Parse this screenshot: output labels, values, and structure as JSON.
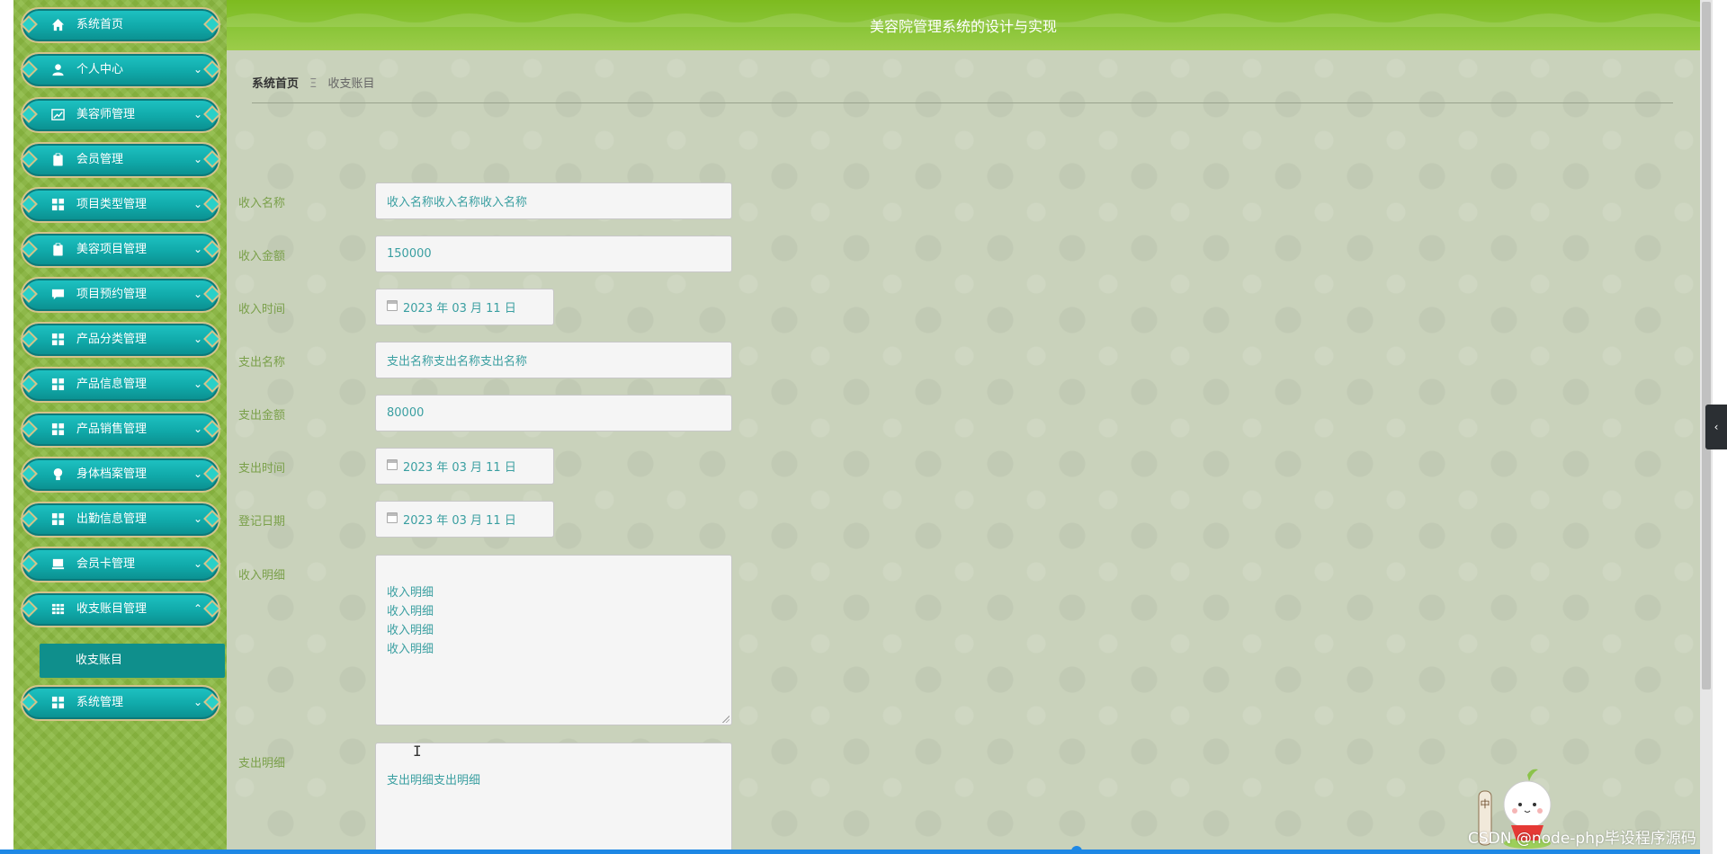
{
  "header": {
    "title": "美容院管理系统的设计与实现"
  },
  "sidebar": {
    "items": [
      {
        "label": "系统首页",
        "icon": "home-icon"
      },
      {
        "label": "个人中心",
        "icon": "user-icon"
      },
      {
        "label": "美容师管理",
        "icon": "chart-icon"
      },
      {
        "label": "会员管理",
        "icon": "clipboard-icon"
      },
      {
        "label": "项目类型管理",
        "icon": "grid-icon"
      },
      {
        "label": "美容项目管理",
        "icon": "clipboard-icon"
      },
      {
        "label": "项目预约管理",
        "icon": "chat-icon"
      },
      {
        "label": "产品分类管理",
        "icon": "grid-icon"
      },
      {
        "label": "产品信息管理",
        "icon": "grid-icon"
      },
      {
        "label": "产品销售管理",
        "icon": "grid-icon"
      },
      {
        "label": "身体档案管理",
        "icon": "bulb-icon"
      },
      {
        "label": "出勤信息管理",
        "icon": "grid-icon"
      },
      {
        "label": "会员卡管理",
        "icon": "monitor-icon"
      },
      {
        "label": "收支账目管理",
        "icon": "table-icon"
      },
      {
        "label": "系统管理",
        "icon": "grid-icon"
      }
    ],
    "submenu": {
      "label": "收支账目"
    }
  },
  "breadcrumb": {
    "home": "系统首页",
    "separator": "Ξ",
    "current": "收支账目"
  },
  "form": {
    "income_name": {
      "label": "收入名称",
      "value": "收入名称收入名称收入名称"
    },
    "income_amount": {
      "label": "收入金额",
      "value": "150000"
    },
    "income_time": {
      "label": "收入时间",
      "value": "2023 年 03 月 11 日"
    },
    "expense_name": {
      "label": "支出名称",
      "value": "支出名称支出名称支出名称"
    },
    "expense_amount": {
      "label": "支出金额",
      "value": "80000"
    },
    "expense_time": {
      "label": "支出时间",
      "value": "2023 年 03 月 11 日"
    },
    "register_date": {
      "label": "登记日期",
      "value": "2023 年 03 月 11 日"
    },
    "income_detail": {
      "label": "收入明细",
      "value": "收入明细\n收入明细\n收入明细\n收入明细"
    },
    "expense_detail": {
      "label": "支出明细",
      "value": "支出明细支出明细"
    }
  },
  "watermark": "CSDN @node-php毕设程序源码",
  "colors": {
    "header": "#8cc63a",
    "sidebar": "#8ab840",
    "menu_teal": "#10a9a9",
    "field_text": "#3a9fa1",
    "label_green": "#7aa04a"
  }
}
